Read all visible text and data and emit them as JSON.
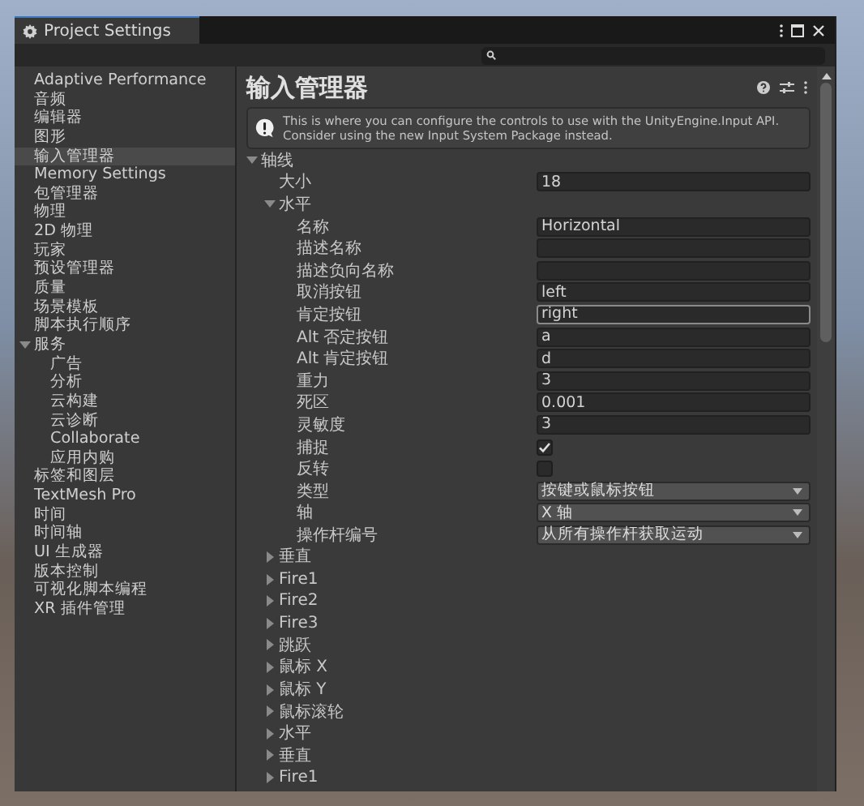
{
  "window": {
    "title": "Project Settings"
  },
  "sidebar": {
    "items": [
      {
        "label": "Adaptive Performance",
        "selected": false
      },
      {
        "label": "音频",
        "selected": false
      },
      {
        "label": "编辑器",
        "selected": false
      },
      {
        "label": "图形",
        "selected": false
      },
      {
        "label": "输入管理器",
        "selected": true
      },
      {
        "label": "Memory Settings",
        "selected": false
      },
      {
        "label": "包管理器",
        "selected": false
      },
      {
        "label": "物理",
        "selected": false
      },
      {
        "label": "2D 物理",
        "selected": false
      },
      {
        "label": "玩家",
        "selected": false
      },
      {
        "label": "预设管理器",
        "selected": false
      },
      {
        "label": "质量",
        "selected": false
      },
      {
        "label": "场景模板",
        "selected": false
      },
      {
        "label": "脚本执行顺序",
        "selected": false
      },
      {
        "label": "服务",
        "selected": false,
        "expanded": true,
        "children": [
          {
            "label": "广告",
            "selected": false
          },
          {
            "label": "分析",
            "selected": false
          },
          {
            "label": "云构建",
            "selected": false
          },
          {
            "label": "云诊断",
            "selected": false
          },
          {
            "label": "Collaborate",
            "selected": false
          },
          {
            "label": "应用内购",
            "selected": false
          }
        ]
      },
      {
        "label": "标签和图层",
        "selected": false
      },
      {
        "label": "TextMesh Pro",
        "selected": false
      },
      {
        "label": "时间",
        "selected": false
      },
      {
        "label": "时间轴",
        "selected": false
      },
      {
        "label": "UI 生成器",
        "selected": false
      },
      {
        "label": "版本控制",
        "selected": false
      },
      {
        "label": "可视化脚本编程",
        "selected": false
      },
      {
        "label": "XR 插件管理",
        "selected": false
      }
    ]
  },
  "content": {
    "title": "输入管理器",
    "info": "This is where you can configure the controls to use with the UnityEngine.Input API. Consider using the new Input System Package instead.",
    "tree": [
      {
        "kind": "group",
        "label": "轴线",
        "expanded": true,
        "children": [
          {
            "kind": "text",
            "label": "大小",
            "value": "18",
            "focused": false
          },
          {
            "kind": "group",
            "label": "水平",
            "expanded": true,
            "children": [
              {
                "kind": "text",
                "label": "名称",
                "value": "Horizontal",
                "focused": false
              },
              {
                "kind": "text",
                "label": "描述名称",
                "focused": false
              },
              {
                "kind": "text",
                "label": "描述负向名称",
                "focused": false
              },
              {
                "kind": "text",
                "label": "取消按钮",
                "value": "left",
                "focused": false
              },
              {
                "kind": "text",
                "label": "肯定按钮",
                "value": "right",
                "focused": true
              },
              {
                "kind": "text",
                "label": "Alt 否定按钮",
                "value": "a",
                "focused": false
              },
              {
                "kind": "text",
                "label": "Alt 肯定按钮",
                "value": "d",
                "focused": false
              },
              {
                "kind": "text",
                "label": "重力",
                "value": "3",
                "focused": false
              },
              {
                "kind": "text",
                "label": "死区",
                "value": "0.001",
                "focused": false
              },
              {
                "kind": "text",
                "label": "灵敏度",
                "value": "3",
                "focused": false
              },
              {
                "kind": "checkbox",
                "label": "捕捉",
                "checked": true
              },
              {
                "kind": "checkbox",
                "label": "反转",
                "checked": false
              },
              {
                "kind": "dropdown",
                "label": "类型",
                "value": "按键或鼠标按钮"
              },
              {
                "kind": "dropdown",
                "label": "轴",
                "value": "X 轴"
              },
              {
                "kind": "dropdown",
                "label": "操作杆编号",
                "value": "从所有操作杆获取运动"
              }
            ]
          },
          {
            "kind": "group",
            "label": "垂直",
            "expanded": false
          },
          {
            "kind": "group",
            "label": "Fire1",
            "expanded": false
          },
          {
            "kind": "group",
            "label": "Fire2",
            "expanded": false
          },
          {
            "kind": "group",
            "label": "Fire3",
            "expanded": false
          },
          {
            "kind": "group",
            "label": "跳跃",
            "expanded": false
          },
          {
            "kind": "group",
            "label": "鼠标 X",
            "expanded": false
          },
          {
            "kind": "group",
            "label": "鼠标 Y",
            "expanded": false
          },
          {
            "kind": "group",
            "label": "鼠标滚轮",
            "expanded": false
          },
          {
            "kind": "group",
            "label": "水平",
            "expanded": false
          },
          {
            "kind": "group",
            "label": "垂直",
            "expanded": false
          },
          {
            "kind": "group",
            "label": "Fire1",
            "expanded": false
          }
        ]
      }
    ]
  }
}
